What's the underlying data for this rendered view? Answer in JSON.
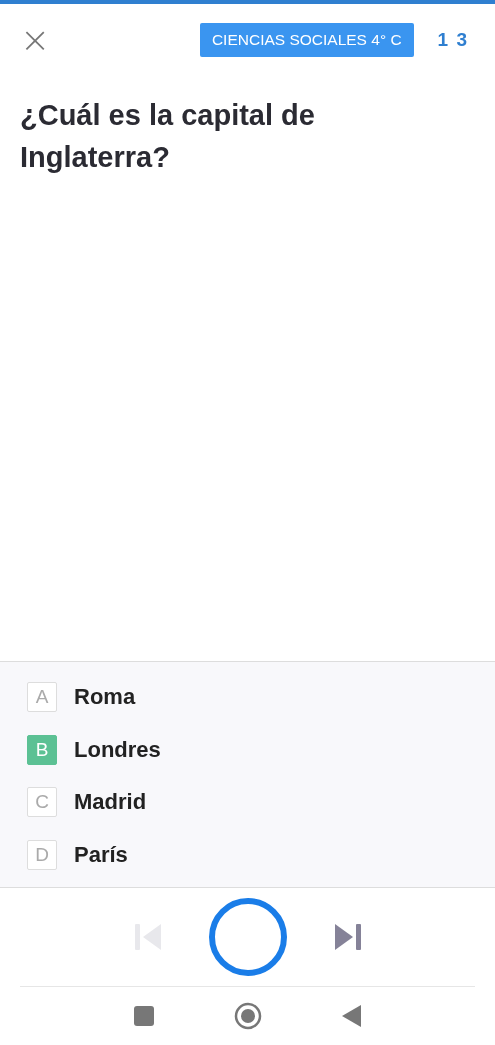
{
  "header": {
    "close": "×",
    "badge": "CIENCIAS SOCIALES 4° C",
    "counter": "1 3"
  },
  "question": "¿Cuál es la capital de Inglaterra?",
  "options": [
    {
      "letter": "A",
      "text": "Roma",
      "selected": false
    },
    {
      "letter": "B",
      "text": "Londres",
      "selected": true
    },
    {
      "letter": "C",
      "text": "Madrid",
      "selected": false
    },
    {
      "letter": "D",
      "text": "París",
      "selected": false
    }
  ],
  "controls": {
    "previous_disabled": true,
    "next_disabled": false
  }
}
